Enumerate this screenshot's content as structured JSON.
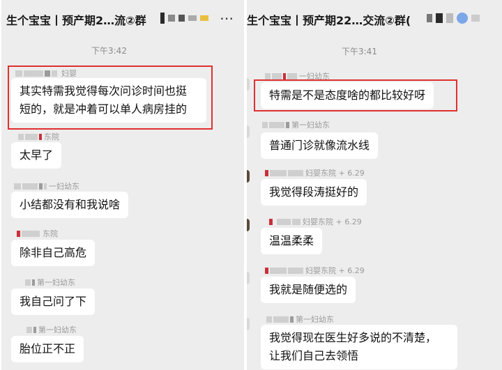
{
  "left": {
    "title": "生个宝宝丨预产期2…流②群",
    "more_icon": "more-dots-icon",
    "time": "下午3:42",
    "messages": [
      {
        "name": "妇婴",
        "text_line1": "其实特需我觉得每次问诊时间也挺",
        "text_line2": "短的，就是冲着可以单人病房挂的"
      },
      {
        "name": "东院",
        "text": "太早了"
      },
      {
        "name": "一妇幼东",
        "text": "小结都没有和我说啥"
      },
      {
        "name": "东院",
        "text": "除非自己高危"
      },
      {
        "name": "第一妇幼东",
        "text": "我自己问了下"
      },
      {
        "name": "第一妇幼东",
        "text": "胎位正不正"
      }
    ]
  },
  "right": {
    "title": "生个宝宝丨预产期22…交流②群(",
    "time": "下午3:41",
    "messages": [
      {
        "name": "一妇幼东",
        "text": "特需是不是态度啥的都比较好呀"
      },
      {
        "name": "第一妇幼东",
        "text": "普通门诊就像流水线"
      },
      {
        "name": "妇婴东院 + 6.29",
        "text": "我觉得段涛挺好的"
      },
      {
        "name": "妇婴东院 + 6.29",
        "text": "温温柔柔"
      },
      {
        "name": "妇婴东院 + 6.29",
        "text": "我就是随便选的"
      },
      {
        "name": "第一妇幼东",
        "text_line1": "我觉得现在医生好多说的不清楚，",
        "text_line2": "让我们自己去领悟"
      }
    ]
  },
  "colors": {
    "background": "#ededed",
    "bubble": "#ffffff",
    "highlight": "#e03030"
  }
}
